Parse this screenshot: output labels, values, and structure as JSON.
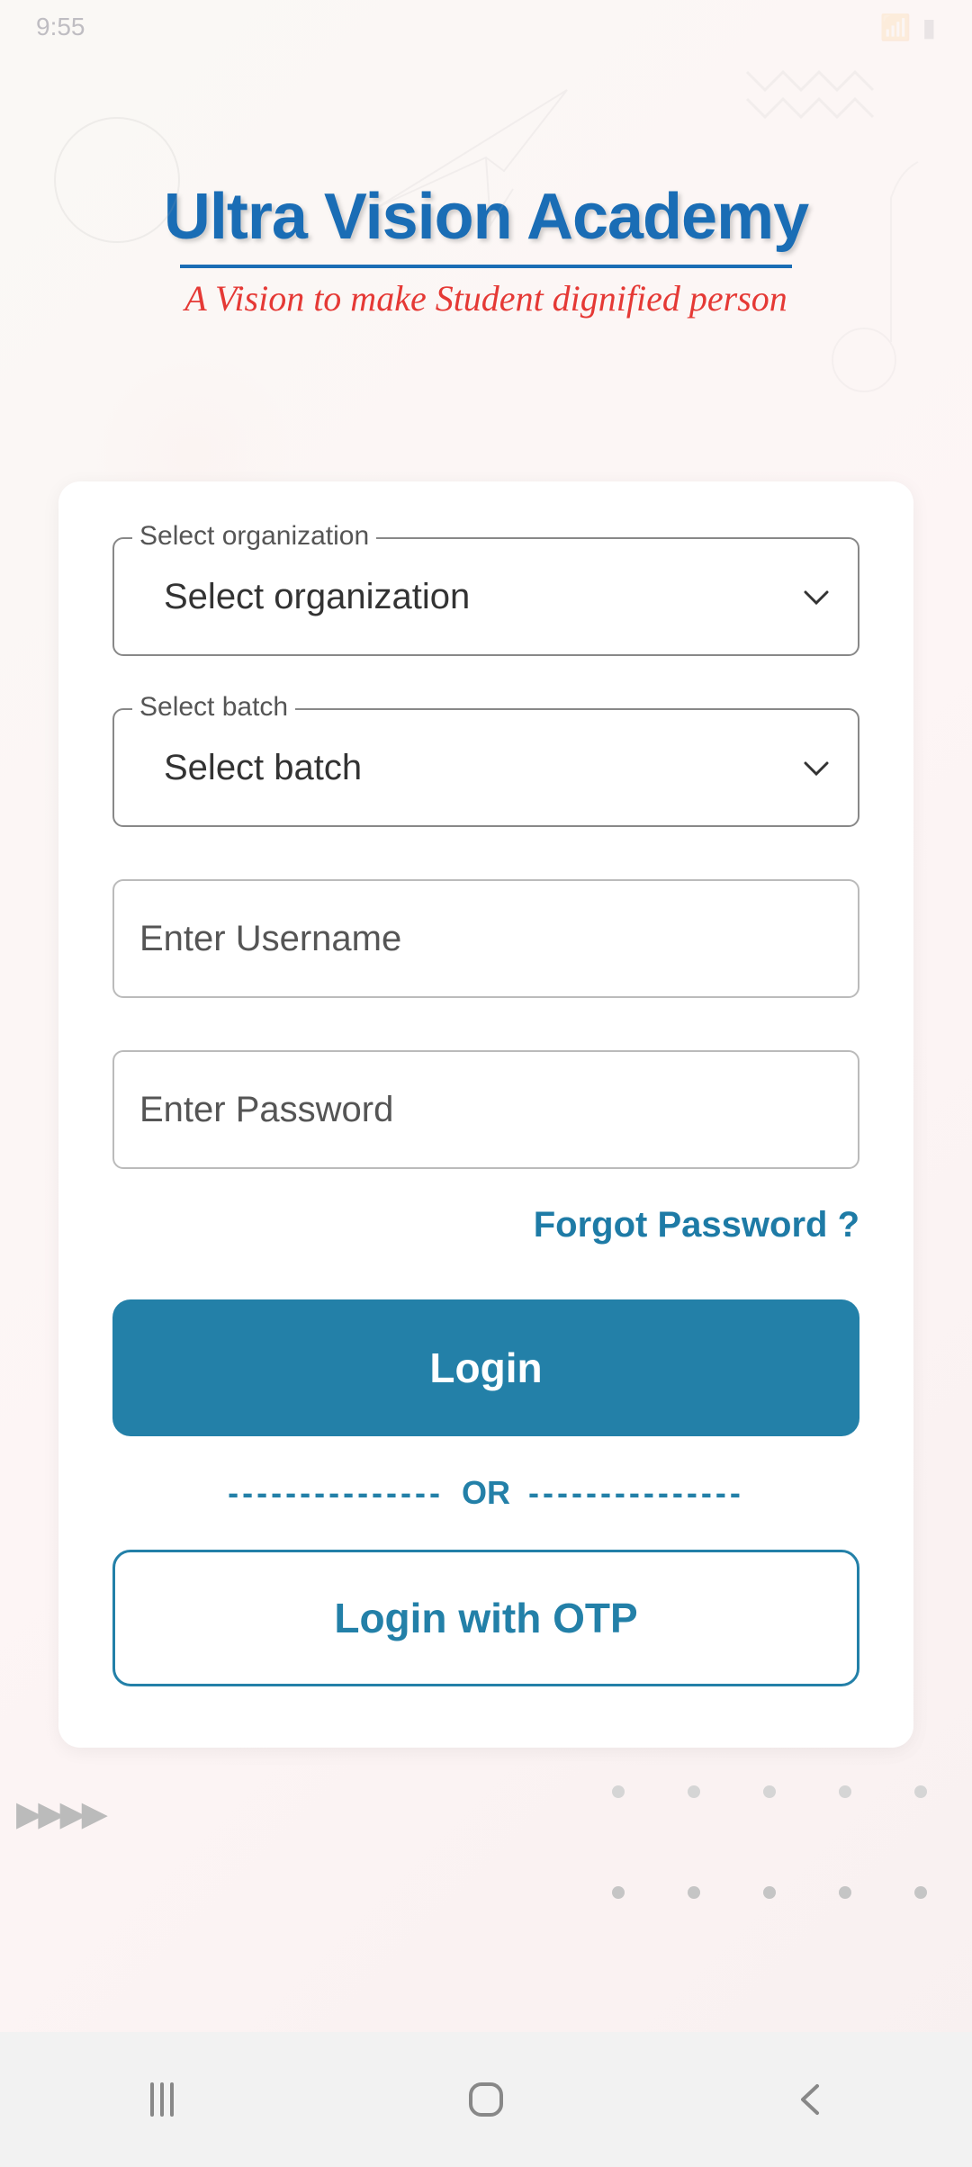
{
  "status": {
    "time": "9:55"
  },
  "logo": {
    "title": "Ultra Vision Academy",
    "tagline": "A Vision to make Student dignified person"
  },
  "form": {
    "org_label": "Select organization",
    "org_placeholder": "Select organization",
    "batch_label": "Select batch",
    "batch_placeholder": "Select batch",
    "username_placeholder": "Enter Username",
    "password_placeholder": "Enter Password",
    "forgot_link": "Forgot Password ?",
    "login_button": "Login",
    "divider": "OR",
    "otp_button": "Login with OTP"
  }
}
